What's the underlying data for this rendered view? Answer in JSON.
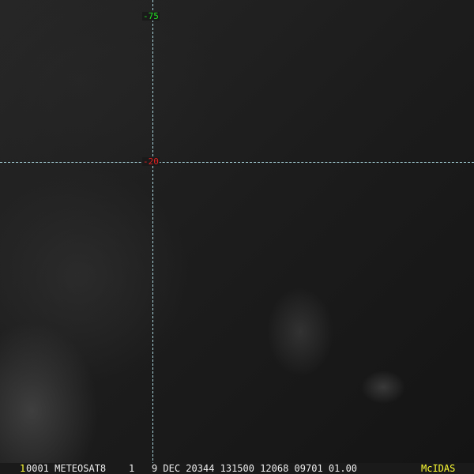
{
  "image": {
    "type": "satellite-imagery",
    "viewer": "McIDAS"
  },
  "grid": {
    "latitude_label": "-75",
    "longitude_label": "-20",
    "line_color": "#a8d4dc",
    "latitude_label_color": "#22e022",
    "longitude_label_color": "#e02020"
  },
  "status_bar": {
    "frame_number": "1",
    "info": "0001 METEOSAT8    1   9 DEC 20344 131500 12068 09701 01.00",
    "brand": "McIDAS",
    "brand_color": "#ffff33"
  }
}
